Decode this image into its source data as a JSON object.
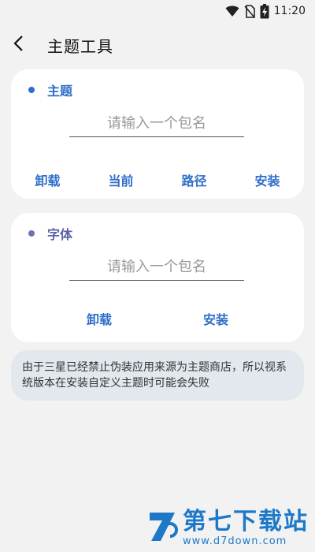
{
  "status_bar": {
    "time": "11:20",
    "icons": [
      "wifi-icon",
      "no-sim-icon",
      "battery-charging-icon"
    ]
  },
  "app_bar": {
    "back_icon": "chevron-left-icon",
    "title": "主题工具"
  },
  "theme_card": {
    "title": "主题",
    "input_placeholder": "请输入一个包名",
    "input_value": "",
    "buttons": {
      "uninstall": "卸载",
      "current": "当前",
      "path": "路径",
      "install": "安装"
    },
    "accent": "#2f6fc9"
  },
  "font_card": {
    "title": "字体",
    "input_placeholder": "请输入一个包名",
    "input_value": "",
    "buttons": {
      "uninstall": "卸载",
      "install": "安装"
    },
    "accent": "#5a62a8"
  },
  "notice": {
    "text": "由于三星已经禁止伪装应用来源为主题商店，所以视系统版本在安装自定义主题时可能会失败"
  },
  "watermark": {
    "name": "第七下载站",
    "url": "www.d7down.com"
  }
}
